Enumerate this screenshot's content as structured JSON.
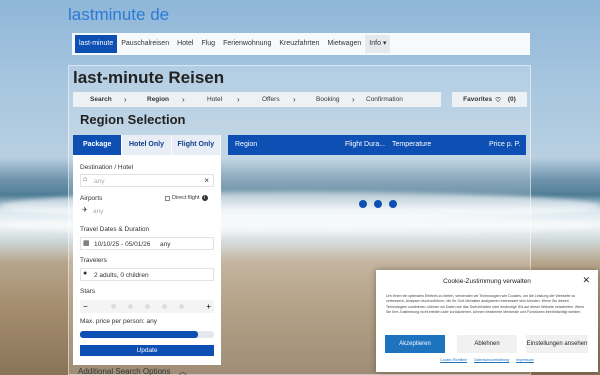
{
  "brand": "lastminute de",
  "topnav": {
    "items": [
      "last-minute",
      "Pauschalreisen",
      "Hotel",
      "Flug",
      "Ferienwohnung",
      "Kreuzfahrten",
      "Mietwagen",
      "Info"
    ],
    "info_caret": "▾"
  },
  "page_title": "last-minute Reisen",
  "steps": [
    "Search",
    "Region",
    "Hotel",
    "Offers",
    "Booking",
    "Confirmation"
  ],
  "favorites": {
    "label": "Favorites",
    "count": "(0)"
  },
  "region_title": "Region Selection",
  "tabs": [
    "Package",
    "Hotel Only",
    "Flight Only"
  ],
  "table_head": {
    "region": "Region",
    "flight_duration": "Flight Dura...",
    "temperature": "Temperature",
    "price": "Price p. P."
  },
  "search": {
    "destination_label": "Destination / Hotel",
    "destination_placeholder": "any",
    "airports_label": "Airports",
    "direct_flight_label": "Direct flight",
    "airports_placeholder": "any",
    "dates_label": "Travel Dates & Duration",
    "dates_value": "10/10/25 - 05/01/26",
    "duration_value": "any",
    "travelers_label": "Travelers",
    "travelers_value": "2 adults, 0 children",
    "stars_label": "Stars",
    "price_label": "Max. price per person: any",
    "price_level_pct": 88,
    "update_label": "Update",
    "additional_options_label": "Additional Search Options"
  },
  "cookie": {
    "title": "Cookie-Zustimmung verwalten",
    "text": "Um Ihnen ein optimales Erlebnis zu bieten, verwenden wir Technologien wie Cookies, um die Leistung der Webseite zu verbessern, Analysen durchzuführen, die Ihr Surf-Verhalten analysieren interessant sein könnten. Wenn Sie diesen Technologien zustimmen, können wir Daten wie das Surfverhalten oder eindeutige IDs auf dieser Website verarbeiten. Wenn Sie Ihre Zustimmung nicht erteilen oder zurückziehen, können bestimmte Merkmale und Funktionen beeinträchtigt werden.",
    "accept_label": "Akzeptieren",
    "deny_label": "Ablehnen",
    "settings_label": "Einstellungen ansehen",
    "links": [
      "Cookie-Richtlinie",
      "Datenschutzerklärung",
      "Impressum"
    ]
  },
  "colors": {
    "primary": "#0d4fb3",
    "brand": "#2a7bd6",
    "cookie_accept": "#1e73be"
  }
}
